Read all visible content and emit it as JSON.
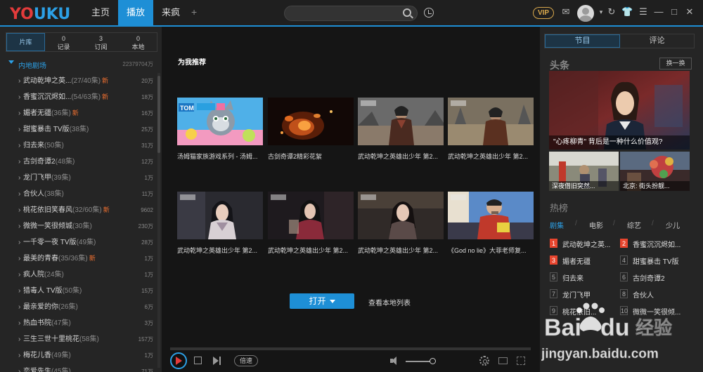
{
  "app": {
    "logo": {
      "y": "Y",
      "o": "O",
      "uku": "UKU"
    },
    "nav_tabs": [
      "主页",
      "播放",
      "来疯"
    ],
    "add_tab": "+",
    "vip": "VIP"
  },
  "left": {
    "tabs": [
      {
        "label": "片库",
        "count": ""
      },
      {
        "label": "记录",
        "count": "0"
      },
      {
        "label": "订阅",
        "count": "3"
      },
      {
        "label": "本地",
        "count": "0"
      }
    ],
    "section": {
      "title": "内地剧场",
      "count": "22379704万"
    },
    "items": [
      {
        "name": "武动乾坤之英...",
        "ep": "(27/40集)",
        "new": "新",
        "count": "20万"
      },
      {
        "name": "香蜜沉沉烬如...",
        "ep": "(54/63集)",
        "new": "新",
        "count": "18万"
      },
      {
        "name": "媚者无疆",
        "ep": "(36集)",
        "new": "新",
        "count": "16万"
      },
      {
        "name": "甜蜜暴击 TV版",
        "ep": "(38集)",
        "new": "",
        "count": "25万"
      },
      {
        "name": "归去来",
        "ep": "(50集)",
        "new": "",
        "count": "31万"
      },
      {
        "name": "古剑奇谭2",
        "ep": "(48集)",
        "new": "",
        "count": "12万"
      },
      {
        "name": "龙门飞甲",
        "ep": "(39集)",
        "new": "",
        "count": "1万"
      },
      {
        "name": "合伙人",
        "ep": "(38集)",
        "new": "",
        "count": "11万"
      },
      {
        "name": "桃花依旧笑春风",
        "ep": "(32/60集)",
        "new": "新",
        "count": "9602"
      },
      {
        "name": "微微一笑很倾城",
        "ep": "(30集)",
        "new": "",
        "count": "230万"
      },
      {
        "name": "一千零一夜 TV版",
        "ep": "(49集)",
        "new": "",
        "count": "28万"
      },
      {
        "name": "最美的青春",
        "ep": "(35/36集)",
        "new": "新",
        "count": "1万"
      },
      {
        "name": "疯人院",
        "ep": "(24集)",
        "new": "",
        "count": "1万"
      },
      {
        "name": "猎毒人 TV版",
        "ep": "(50集)",
        "new": "",
        "count": "15万"
      },
      {
        "name": "最亲爱的你",
        "ep": "(26集)",
        "new": "",
        "count": "6万"
      },
      {
        "name": "热血书院",
        "ep": "(47集)",
        "new": "",
        "count": "3万"
      },
      {
        "name": "三生三世十里桃花",
        "ep": "(58集)",
        "new": "",
        "count": "157万"
      },
      {
        "name": "梅花儿香",
        "ep": "(49集)",
        "new": "",
        "count": "1万"
      },
      {
        "name": "恋爱先生",
        "ep": "(45集)",
        "new": "",
        "count": "71万"
      }
    ]
  },
  "center": {
    "rec_title": "为我推荐",
    "videos": [
      {
        "title": "汤姆猫家族游戏系列 - 汤姆...",
        "art": "cartoon"
      },
      {
        "title": "古剑奇谭2精彩花絮",
        "art": "fire"
      },
      {
        "title": "武动乾坤之英雄出少年 第2...",
        "art": "warrior"
      },
      {
        "title": "武动乾坤之英雄出少年 第2...",
        "art": "warrior2"
      },
      {
        "title": "武动乾坤之英雄出少年 第2...",
        "art": "lady"
      },
      {
        "title": "武动乾坤之英雄出少年 第2...",
        "art": "lady2"
      },
      {
        "title": "武动乾坤之英雄出少年 第2...",
        "art": "lady3"
      },
      {
        "title": "《God no lie》大菲老师复...",
        "art": "host"
      }
    ],
    "open_button": "打开",
    "local_list": "查看本地列表",
    "speed": "倍速"
  },
  "right": {
    "tabs": [
      "节目",
      "评论"
    ],
    "headline": "头条",
    "refresh": "换一换",
    "big_news": "\"心疼柳青\" 背后是一种什么价值观?",
    "small_news": [
      "深夜借旧突然...",
      "北京: 街头扮靓..."
    ],
    "hot_title": "热榜",
    "hot_cats": [
      "剧集",
      "电影",
      "综艺",
      "少儿"
    ],
    "ranking": [
      {
        "num": "1",
        "name": "武动乾坤之英..."
      },
      {
        "num": "2",
        "name": "香蜜沉沉烬如..."
      },
      {
        "num": "3",
        "name": "媚者无疆"
      },
      {
        "num": "4",
        "name": "甜蜜暴击 TV版"
      },
      {
        "num": "5",
        "name": "归去来"
      },
      {
        "num": "6",
        "name": "古剑奇谭2"
      },
      {
        "num": "7",
        "name": "龙门飞甲"
      },
      {
        "num": "8",
        "name": "合伙人"
      },
      {
        "num": "9",
        "name": "桃花依旧..."
      },
      {
        "num": "10",
        "name": "微微一笑很倾..."
      }
    ]
  },
  "watermark": {
    "brand": "Baidu经验",
    "url": "jingyan.baidu.com"
  },
  "colors": {
    "accent": "#1e8fd6",
    "logo_red": "#e23b3b",
    "logo_blue": "#2ca0e6",
    "new_tag": "#f07030",
    "rank_top": "#e8452e",
    "vip_gold": "#d8a84c"
  }
}
